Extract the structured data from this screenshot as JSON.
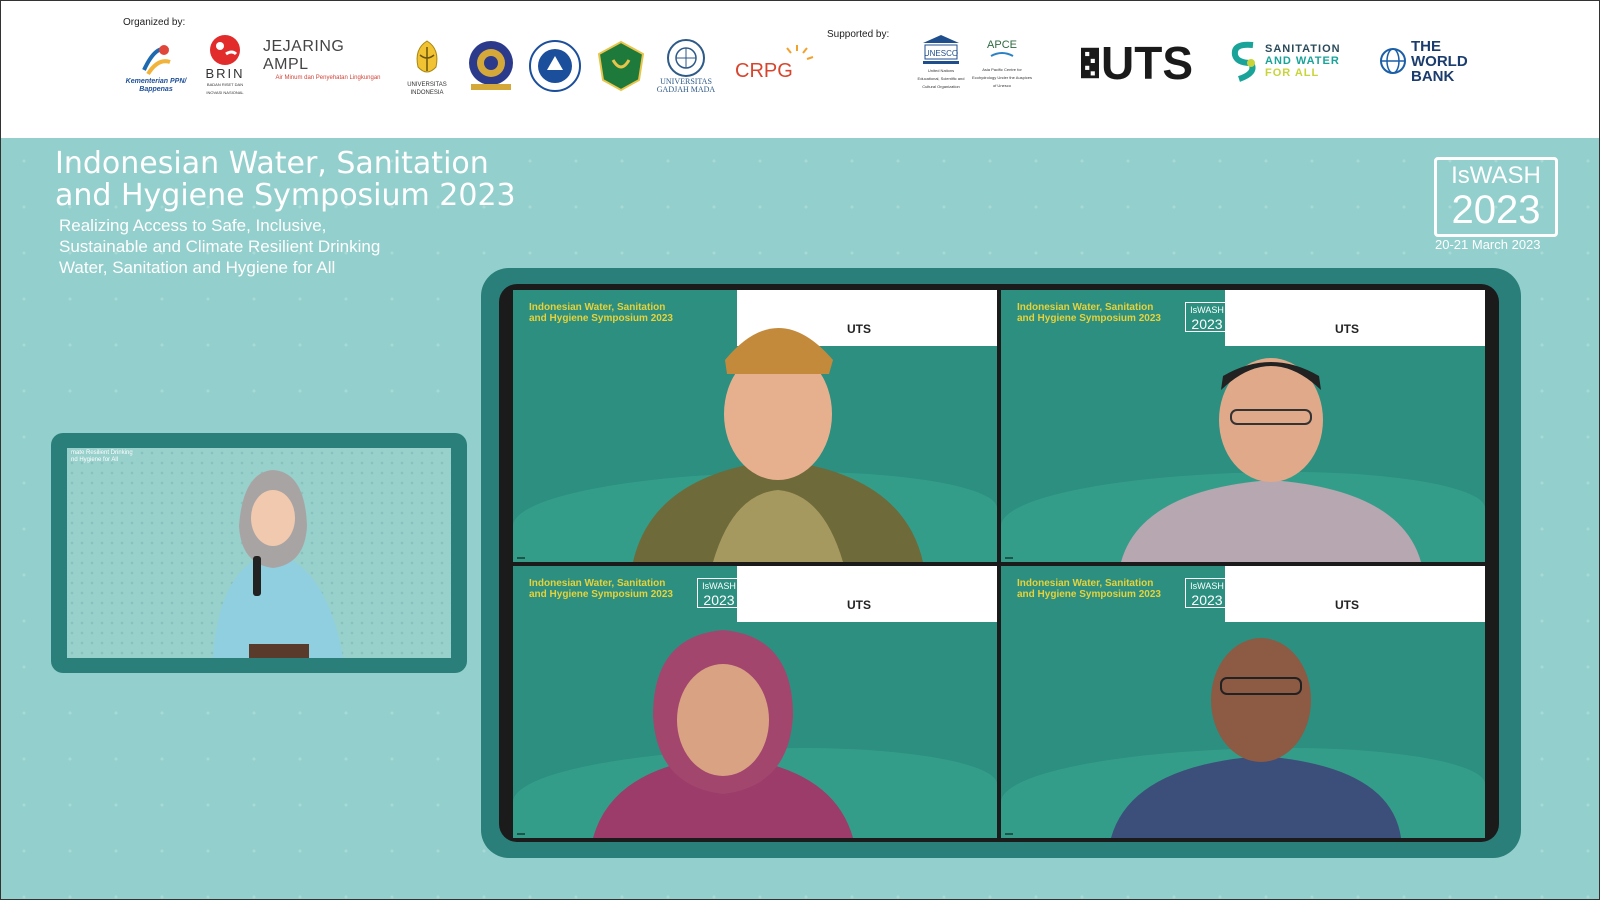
{
  "header": {
    "organized_label": "Organized by:",
    "supported_label": "Supported by:",
    "organizers": [
      {
        "name": "Kementerian PPN/ Bappenas",
        "icon": "bappenas-logo"
      },
      {
        "name": "BRIN",
        "caption": "BADAN RISET DAN INOVASI NASIONAL",
        "icon": "brin-logo"
      },
      {
        "name": "JEJARING AMPL",
        "caption": "Air Minum dan Penyehatan Lingkungan",
        "icon": "ampl-logo"
      },
      {
        "name": "UNIVERSITAS INDONESIA",
        "icon": "ui-seal"
      },
      {
        "name": "UNIVERSITAS UDAYANA",
        "icon": "udayana-seal"
      },
      {
        "name": "INSTITUT TEKNOLOGI BANDUNG",
        "icon": "itb-seal"
      },
      {
        "name": "UNIVERSITAS ANDALAS",
        "icon": "andalas-seal"
      },
      {
        "name": "UNIVERSITAS GADJAH MADA",
        "icon": "ugm-seal"
      },
      {
        "name": "CRPG",
        "icon": "crpg-logo"
      }
    ],
    "supporters": [
      {
        "name": "UNESCO",
        "caption": "United Nations Educational, Scientific and Cultural Organization",
        "icon": "unesco-logo"
      },
      {
        "name": "APCE",
        "caption": "Asia Pacific Centre for Ecohydrology Under the Auspices of Unesco",
        "icon": "apce-logo"
      },
      {
        "name": "UTS",
        "icon": "uts-logo"
      },
      {
        "name": "SANITATION AND WATER FOR ALL",
        "line1": "SANITATION",
        "line2": "AND WATER",
        "line3": "FOR ALL",
        "icon": "swa-logo"
      },
      {
        "name": "THE WORLD BANK",
        "line1": "THE",
        "line2": "WORLD",
        "line3": "BANK",
        "icon": "worldbank-globe"
      }
    ]
  },
  "event": {
    "title_line1": "Indonesian Water, Sanitation",
    "title_line2": "and Hygiene Symposium 2023",
    "subtitle_line1": "Realizing Access to Safe, Inclusive,",
    "subtitle_line2": "Sustainable and Climate Resilient Drinking",
    "subtitle_line3": "Water, Sanitation and Hygiene for All",
    "badge_line1": "IsWASH",
    "badge_line2": "2023",
    "date": "20-21 March 2023"
  },
  "host": {
    "caption_line1": "mate Resilient Drinking",
    "caption_line2": "nd Hygiene for All"
  },
  "tiles": {
    "title_line1": "Indonesian Water, Sanitation",
    "title_line2": "and Hygiene Symposium 2023",
    "badge_line1": "IsWASH",
    "badge_line2": "2023",
    "uts": "UTS",
    "participants": [
      {
        "name": "",
        "position": "top-left"
      },
      {
        "name": "",
        "position": "top-right"
      },
      {
        "name": "",
        "position": "bottom-left"
      },
      {
        "name": "",
        "position": "bottom-right"
      }
    ]
  },
  "colors": {
    "teal_bg": "#93cfcc",
    "dark_teal": "#2a7f7a",
    "tile_green": "#2c8f80",
    "accent_yellow": "#e6d23a"
  }
}
